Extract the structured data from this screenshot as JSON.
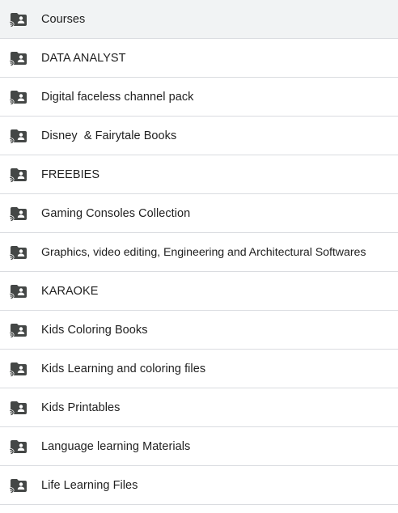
{
  "folder_list": {
    "items": [
      {
        "name": "Courses",
        "icon": "shared-folder-icon",
        "selected": true
      },
      {
        "name": "DATA ANALYST",
        "icon": "shared-folder-icon"
      },
      {
        "name": "Digital faceless channel pack",
        "icon": "shared-folder-icon"
      },
      {
        "name": "Disney  & Fairytale Books",
        "icon": "shared-folder-icon"
      },
      {
        "name": "FREEBIES",
        "icon": "shared-folder-icon"
      },
      {
        "name": "Gaming Consoles Collection",
        "icon": "shared-folder-icon"
      },
      {
        "name": "Graphics, video editing, Engineering and Architectural Softwares",
        "icon": "shared-folder-icon"
      },
      {
        "name": "KARAOKE",
        "icon": "shared-folder-icon"
      },
      {
        "name": "Kids Coloring Books",
        "icon": "shared-folder-icon"
      },
      {
        "name": "Kids Learning and coloring files",
        "icon": "shared-folder-icon"
      },
      {
        "name": "Kids Printables",
        "icon": "shared-folder-icon"
      },
      {
        "name": "Language learning Materials",
        "icon": "shared-folder-icon"
      },
      {
        "name": "Life Learning Files",
        "icon": "shared-folder-icon"
      }
    ]
  },
  "colors": {
    "selected_row_bg": "#f1f3f4",
    "divider": "#dadce0",
    "text": "#1f1f1f",
    "icon": "#444746"
  }
}
